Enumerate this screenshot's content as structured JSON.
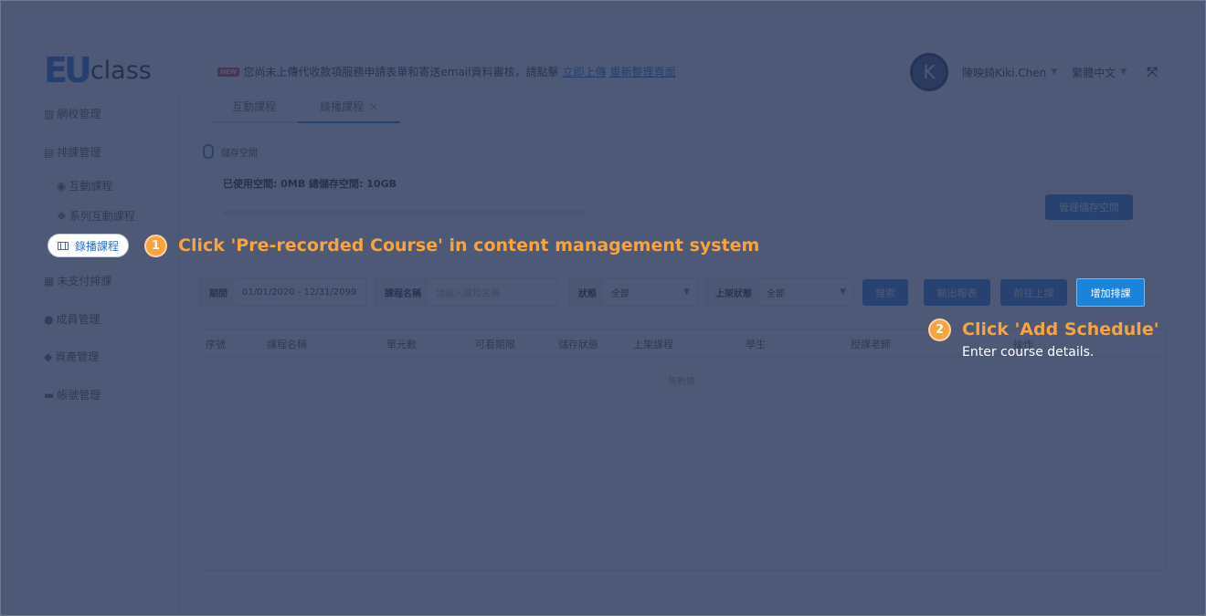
{
  "app": {
    "logo_mark": "EU",
    "logo_text": "class"
  },
  "notice": {
    "badge": "NEW",
    "text": "您尚未上傳代收款項服務申請表單和寄送email資料審核，請點擊",
    "link_upload": "立即上傳",
    "link_refresh": "重新整理頁面"
  },
  "header": {
    "avatar_initial": "K",
    "user_name": "陳映錡Kiki.Chen",
    "language": "繁體中文"
  },
  "sidebar": {
    "items": [
      {
        "label": "網校管理",
        "icon": "bank-icon"
      },
      {
        "label": "排課管理",
        "icon": "document-icon"
      },
      {
        "label": "互動課程",
        "icon": "eye-icon"
      },
      {
        "label": "系列互動課程",
        "icon": "cubes-icon"
      },
      {
        "label": "錄播課程",
        "icon": "film-icon"
      },
      {
        "label": "未支付排課",
        "icon": "grid-icon"
      },
      {
        "label": "成員管理",
        "icon": "user-icon"
      },
      {
        "label": "資產管理",
        "icon": "diamond-icon"
      },
      {
        "label": "帳號管理",
        "icon": "briefcase-icon"
      }
    ]
  },
  "tabs": [
    {
      "label": "互動課程"
    },
    {
      "label": "錄播課程",
      "close": "×"
    }
  ],
  "storage": {
    "title": "儲存空間",
    "usage": "已使用空間: 0MB   總儲存空間: 10GB",
    "used_fraction": 0,
    "manage_button": "管理儲存空間"
  },
  "filters": {
    "period_label": "期間",
    "period_value": "01/01/2020 - 12/31/2099",
    "course_name_label": "課程名稱",
    "course_name_placeholder": "請輸入課程名稱",
    "status_label": "狀態",
    "status_value": "全部",
    "listing_label": "上架狀態",
    "listing_value": "全部"
  },
  "buttons": {
    "search": "搜索",
    "export": "輸出報表",
    "go_class": "前往上課",
    "add_schedule": "增加排課"
  },
  "table": {
    "columns": [
      "序號",
      "課程名稱",
      "單元數",
      "可看期限",
      "儲存狀態",
      "上架課程",
      "學生",
      "授課老師",
      "操作"
    ],
    "empty_text": "無數據"
  },
  "guide": {
    "step1_number": "1",
    "step1_title": "Click 'Pre-recorded Course' in content management system",
    "step2_number": "2",
    "step2_title": "Click 'Add Schedule'",
    "step2_desc": "Enter course details."
  },
  "colors": {
    "overlay": "#263458",
    "accent": "#f7a340",
    "primary": "#2f7fe0"
  }
}
